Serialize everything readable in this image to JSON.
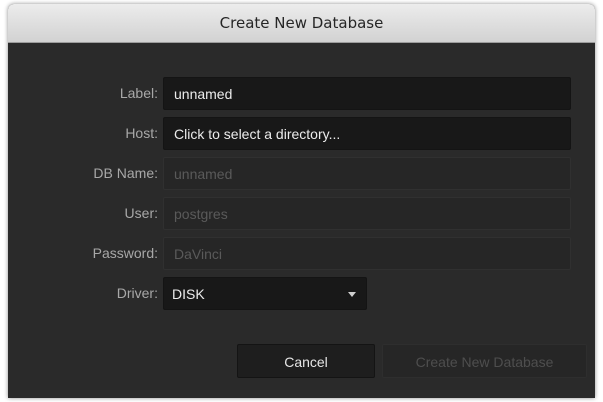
{
  "dialog": {
    "title": "Create New Database"
  },
  "form": {
    "label": {
      "label": "Label:",
      "value": "unnamed"
    },
    "host": {
      "label": "Host:",
      "value": "Click to select a directory..."
    },
    "db_name": {
      "label": "DB Name:",
      "value": "unnamed"
    },
    "user": {
      "label": "User:",
      "value": "postgres"
    },
    "password": {
      "label": "Password:",
      "value": "DaVinci"
    },
    "driver": {
      "label": "Driver:",
      "value": "DISK"
    }
  },
  "buttons": {
    "cancel": "Cancel",
    "create": "Create New Database"
  },
  "colors": {
    "background": "#2a2a2a",
    "field_active": "#181818",
    "field_disabled": "#262626",
    "label_text": "#a8a8a8"
  }
}
